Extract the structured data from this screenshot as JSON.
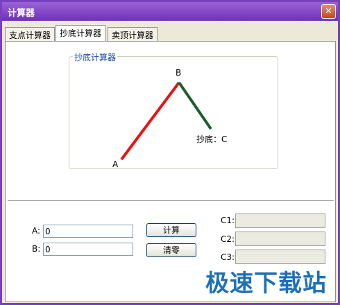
{
  "window": {
    "title": "计算器",
    "close_symbol": "✕"
  },
  "tabs": [
    {
      "label": "支点计算器"
    },
    {
      "label": "抄底计算器",
      "active": true
    },
    {
      "label": "卖顶计算器"
    }
  ],
  "group": {
    "title": "抄底计算器",
    "diagram": {
      "point_a": "A",
      "point_b": "B",
      "point_c": "抄底：C"
    }
  },
  "inputs": {
    "a_label": "A:",
    "a_value": "0",
    "b_label": "B:",
    "b_value": "0"
  },
  "buttons": {
    "calc": "计算",
    "clear": "清零"
  },
  "outputs": {
    "c1_label": "C1:",
    "c2_label": "C2:",
    "c3_label": "C3:",
    "c1": "",
    "c2": "",
    "c3": ""
  },
  "watermark": "极速下载站",
  "colors": {
    "rise_line": "#ee1111",
    "fall_line": "#1a5e2e",
    "title_bar": "#7a3fc0",
    "group_title": "#1548a8"
  }
}
